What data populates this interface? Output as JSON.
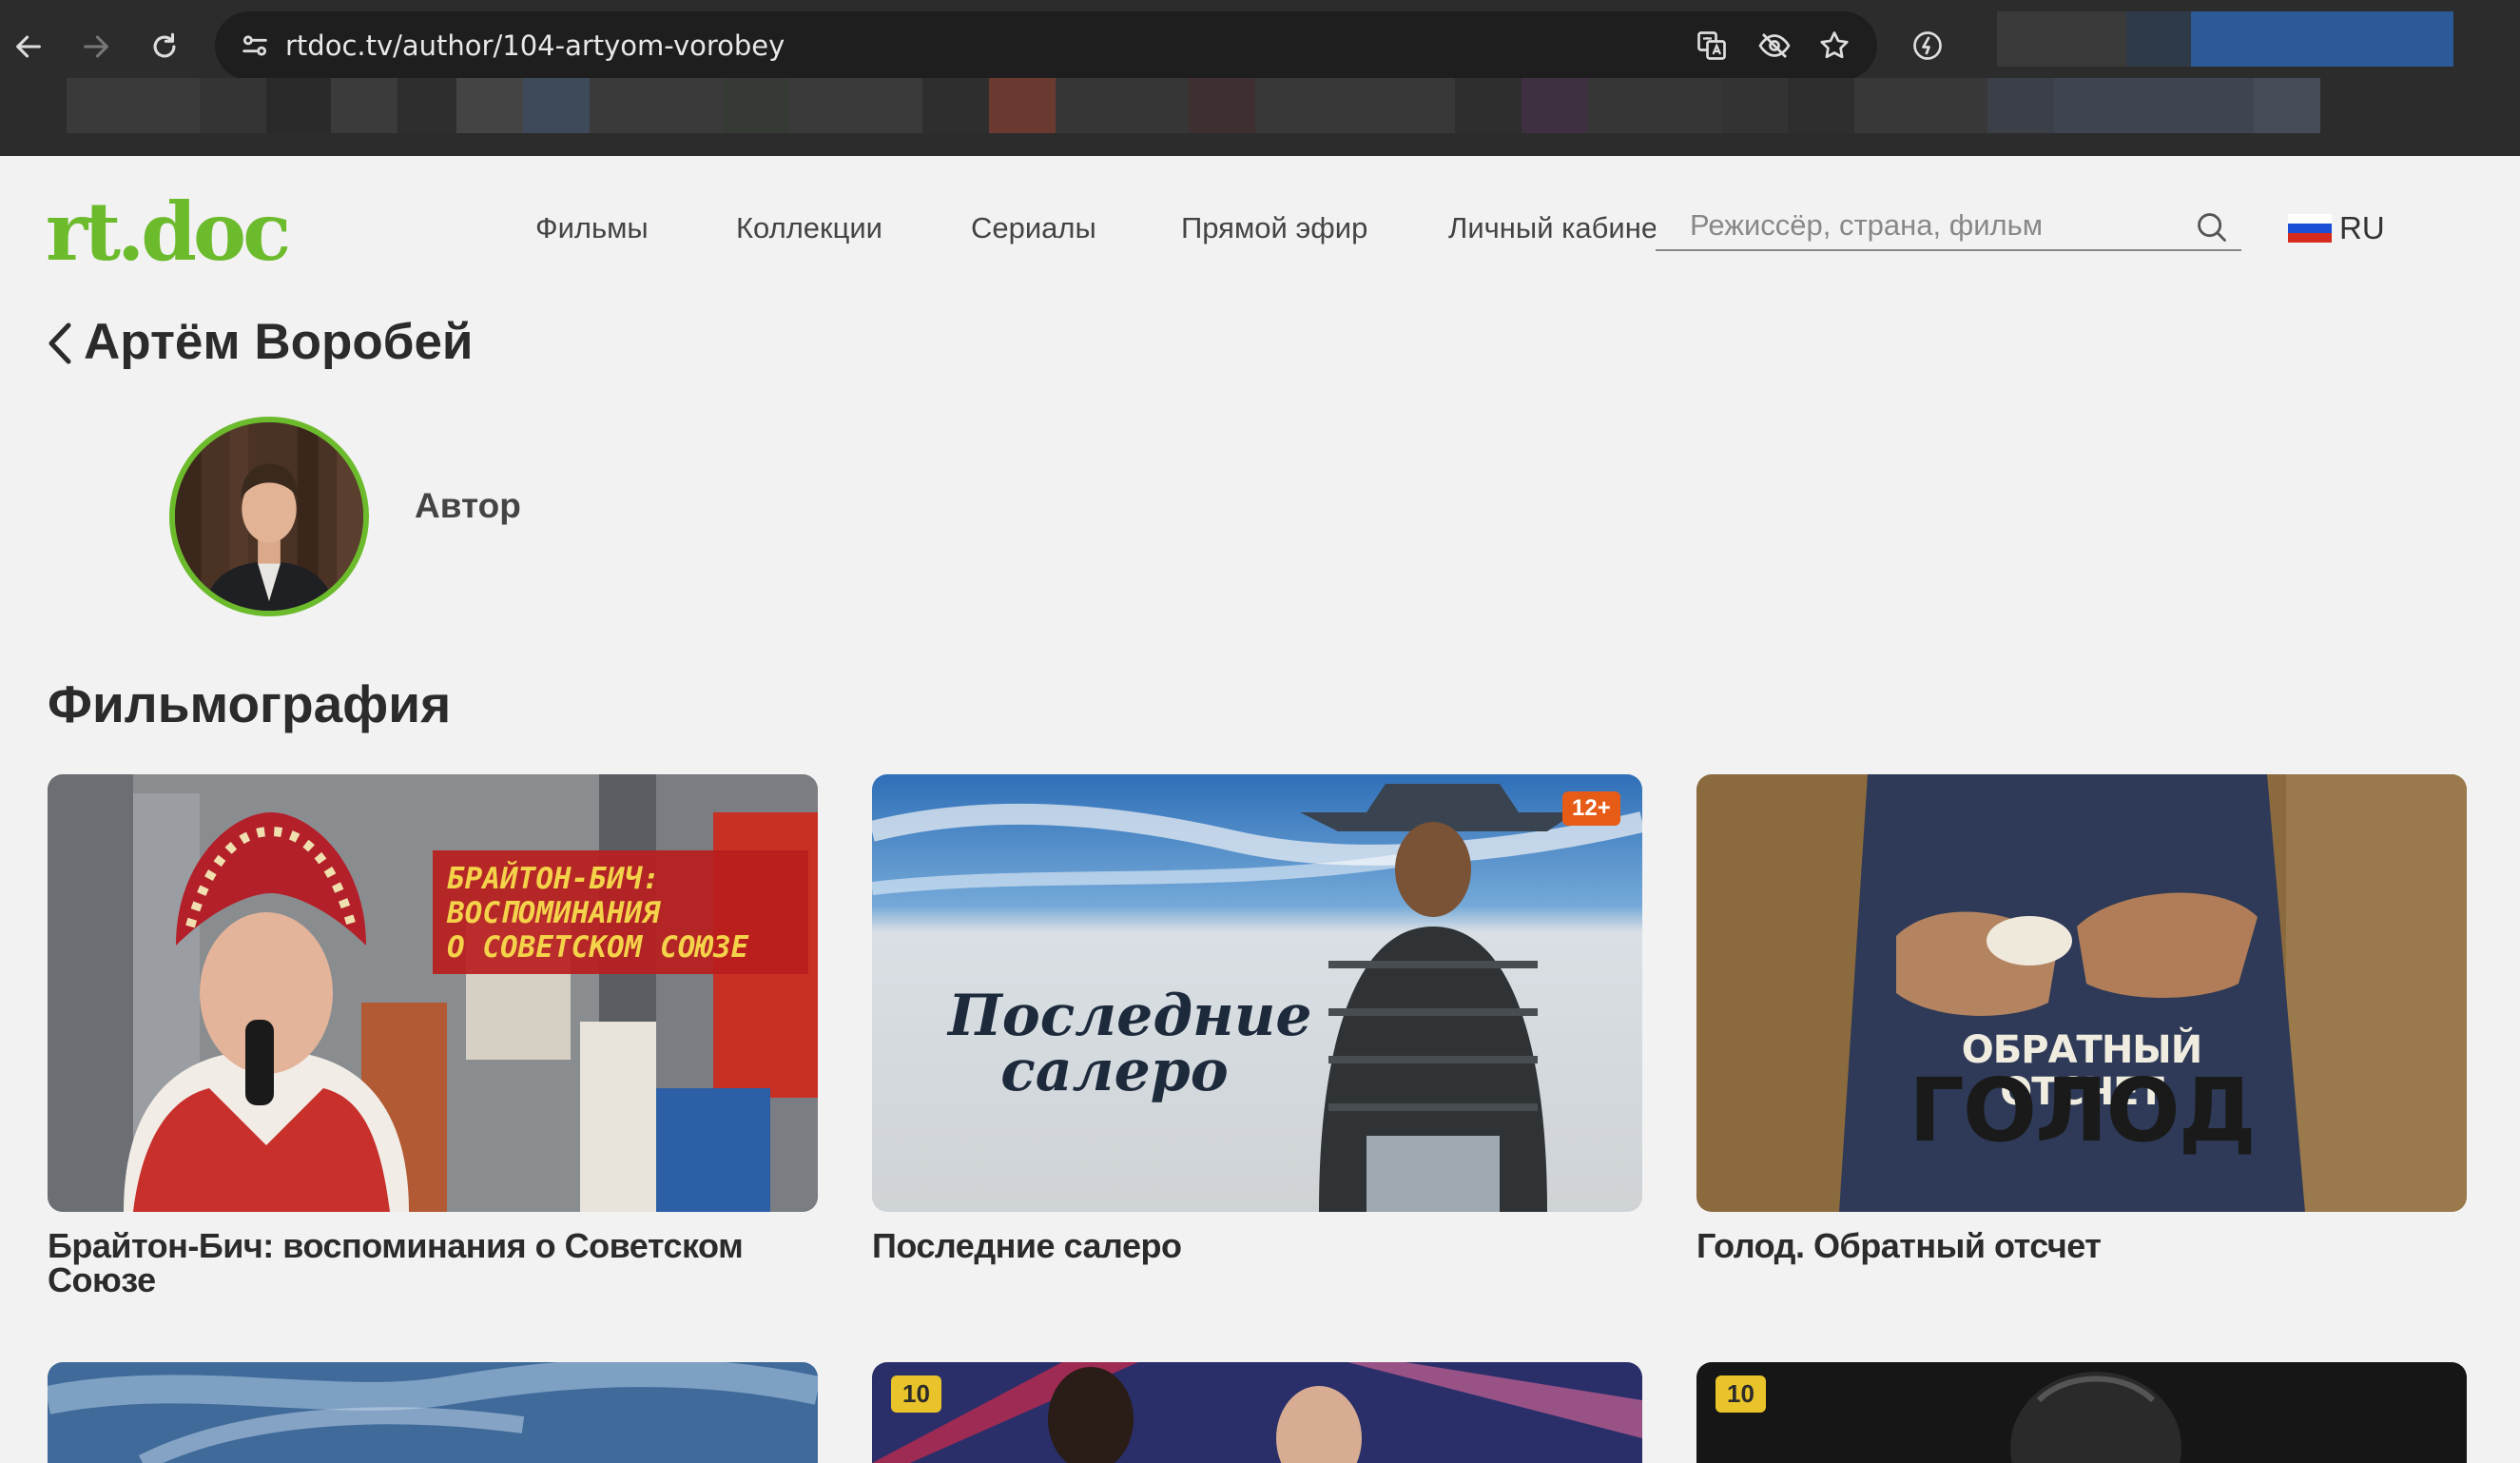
{
  "browser": {
    "url": "rtdoc.tv/author/104-artyom-vorobey"
  },
  "site": {
    "logo": "rt.doc",
    "menu": [
      "Фильмы",
      "Коллекции",
      "Сериалы",
      "Прямой эфир",
      "Личный кабинет"
    ],
    "search_placeholder": "Режиссёр, страна, фильм",
    "language": "RU"
  },
  "author": {
    "name": "Артём Воробей",
    "role": "Автор"
  },
  "filmography": {
    "title": "Фильмография",
    "films": [
      {
        "title": "Брайтон-Бич: воспоминания о Советском Союзе",
        "poster_text": "БРАЙТОН-БИЧ: ВОСПОМИНАНИЯ О СОВЕТСКОМ СОЮЗЕ",
        "poster_line1": "БРАЙТОН-БИЧ:",
        "poster_line2": "ВОСПОМИНАНИЯ",
        "poster_line3": "О СОВЕТСКОМ СОЮЗЕ"
      },
      {
        "title": "Последние салеро",
        "age": "12+",
        "poster_line1": "Последние",
        "poster_line2": "салеро"
      },
      {
        "title": "Голод. Обратный отсчет",
        "poster_line1": "ОБРАТНЫЙ ОТСЧЕТ",
        "poster_line2": "ГОЛОД"
      },
      {
        "title": ""
      },
      {
        "title": "",
        "rating": "10"
      },
      {
        "title": "",
        "rating": "10"
      }
    ]
  },
  "colors": {
    "brand_green": "#6cbb2c",
    "age_badge": "#e65c17",
    "rating_badge": "#e8c32a"
  }
}
